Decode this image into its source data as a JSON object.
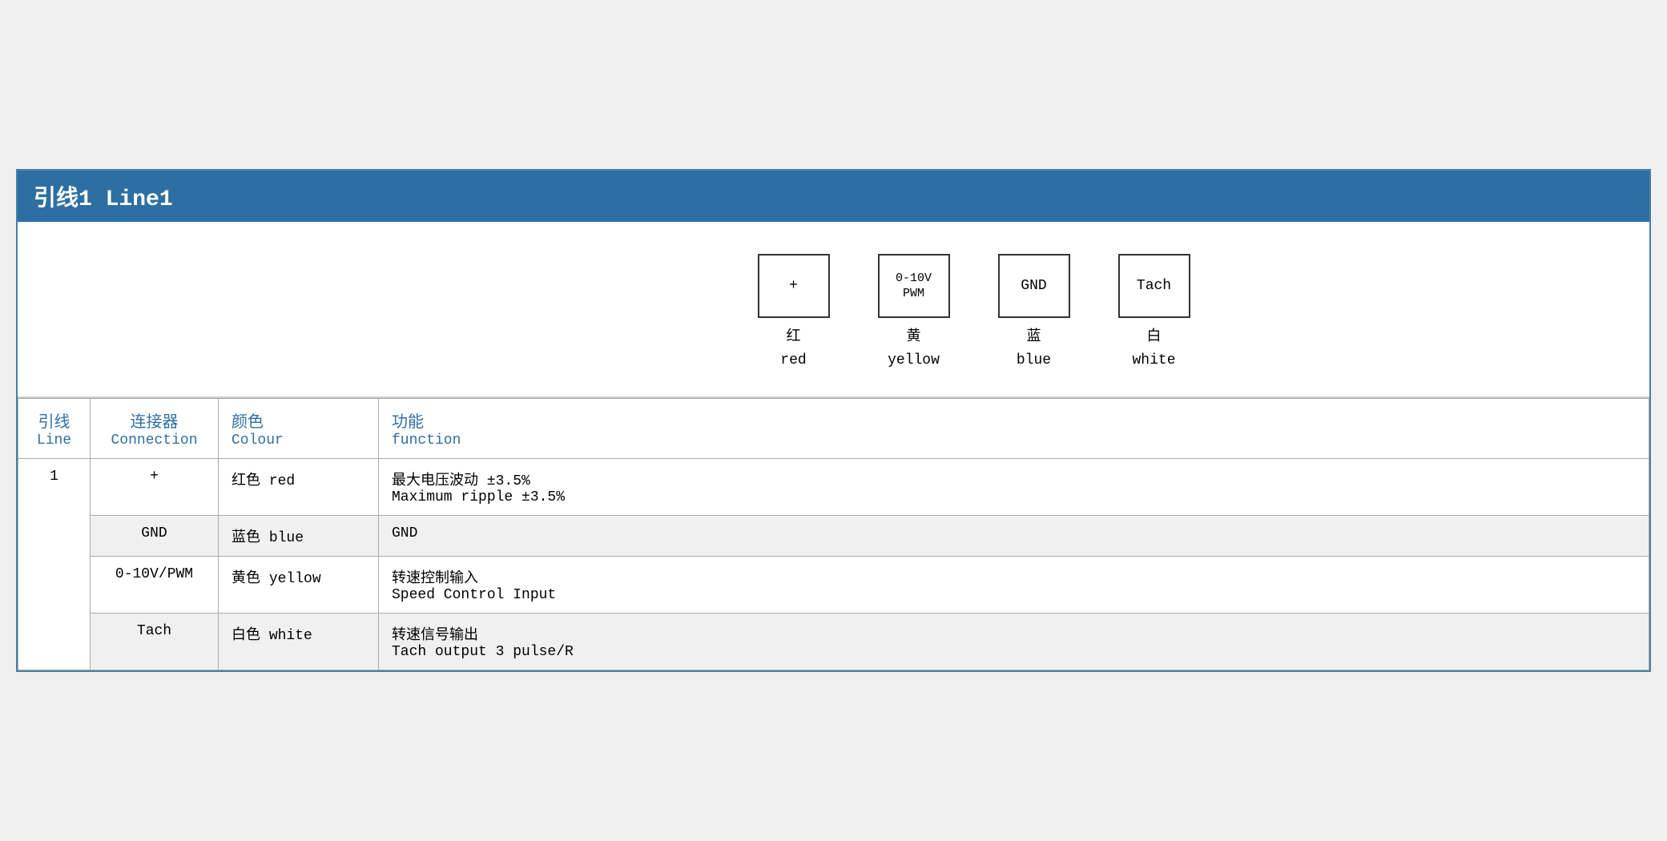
{
  "title": "引线1 Line1",
  "diagram": {
    "pins": [
      {
        "label": "+",
        "chinese": "红",
        "english": "red"
      },
      {
        "label": "0-10V\nPWM",
        "chinese": "黄",
        "english": "yellow"
      },
      {
        "label": "GND",
        "chinese": "蓝",
        "english": "blue"
      },
      {
        "label": "Tach",
        "chinese": "白",
        "english": "white"
      }
    ]
  },
  "table": {
    "headers": {
      "line_chinese": "引线",
      "line_english": "Line",
      "connection_chinese": "连接器",
      "connection_english": "Connection",
      "colour_chinese": "颜色",
      "colour_english": "Colour",
      "function_chinese": "功能",
      "function_english": "function"
    },
    "rows": [
      {
        "line": "1",
        "connection": "+",
        "colour_chinese": "红色",
        "colour_english": "red",
        "function_chinese": "最大电压波动 ±3.5%",
        "function_english": "Maximum ripple ±3.5%",
        "shaded": false
      },
      {
        "line": "",
        "connection": "GND",
        "colour_chinese": "蓝色",
        "colour_english": "blue",
        "function_chinese": "GND",
        "function_english": "",
        "shaded": true
      },
      {
        "line": "",
        "connection": "0-10V/PWM",
        "colour_chinese": "黄色",
        "colour_english": "yellow",
        "function_chinese": "转速控制输入",
        "function_english": "Speed Control Input",
        "shaded": false
      },
      {
        "line": "",
        "connection": "Tach",
        "colour_chinese": "白色",
        "colour_english": "white",
        "function_chinese": "转速信号输出",
        "function_english": "Tach output 3 pulse/R",
        "shaded": true
      }
    ]
  },
  "colors": {
    "title_bg": "#2e6fa3",
    "title_text": "#ffffff",
    "accent": "#2e6fa3",
    "border": "#aaaaaa",
    "shaded_row": "#f5f5f5"
  }
}
